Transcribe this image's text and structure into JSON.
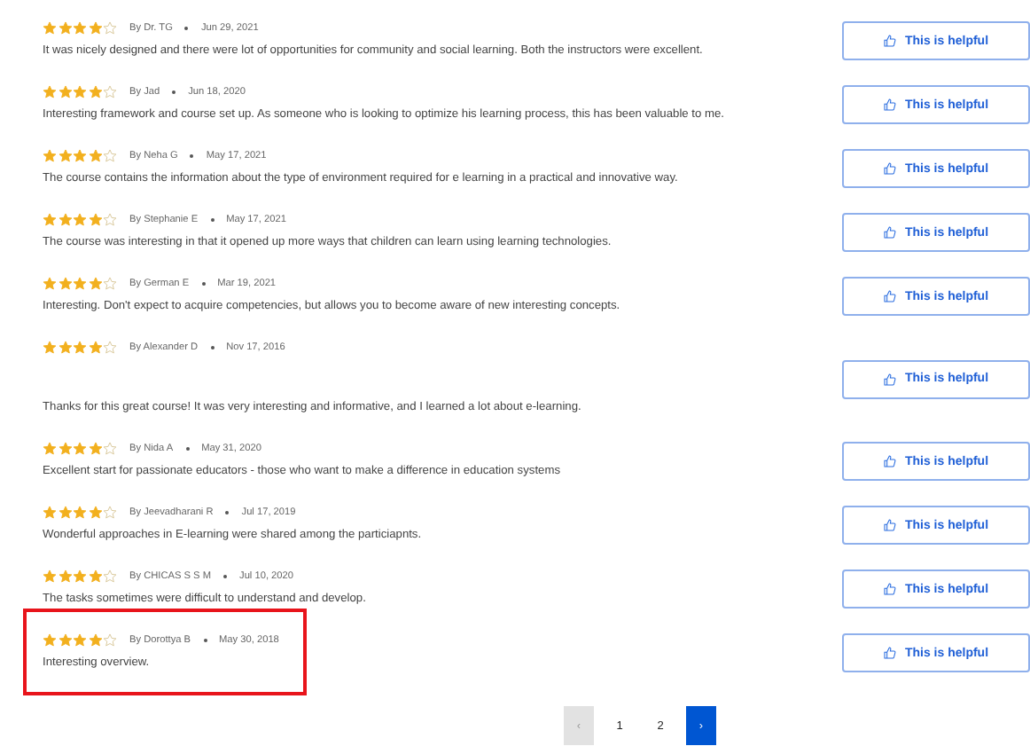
{
  "reviews": [
    {
      "stars": 4,
      "author": "By Dr. TG",
      "date": "Jun 29, 2021",
      "text": "It was nicely designed and there were lot of opportunities for community and social learning. Both the instructors were excellent.",
      "blank_line_before": false,
      "highlighted": false,
      "button": "This is helpful"
    },
    {
      "stars": 4,
      "author": "By Jad",
      "date": "Jun 18, 2020",
      "text": "Interesting framework and course set up. As someone who is looking to optimize his learning process, this has been valuable to me.",
      "blank_line_before": false,
      "highlighted": false,
      "button": "This is helpful"
    },
    {
      "stars": 4,
      "author": "By Neha G",
      "date": "May 17, 2021",
      "text": "The course contains the information about the type of environment required for e learning in a practical and innovative way.",
      "blank_line_before": false,
      "highlighted": false,
      "button": "This is helpful"
    },
    {
      "stars": 4,
      "author": "By Stephanie E",
      "date": "May 17, 2021",
      "text": "The course was interesting in that it opened up more ways that children can learn using learning technologies.",
      "blank_line_before": false,
      "highlighted": false,
      "button": "This is helpful"
    },
    {
      "stars": 4,
      "author": "By German E",
      "date": "Mar 19, 2021",
      "text": "Interesting. Don't expect to acquire competencies, but allows you to become aware of new interesting concepts.",
      "blank_line_before": false,
      "highlighted": false,
      "button": "This is helpful"
    },
    {
      "stars": 4,
      "author": "By Alexander D",
      "date": "Nov 17, 2016",
      "text": "Thanks for this great course! It was very interesting and informative, and I learned a lot about e-learning.",
      "blank_line_before": true,
      "highlighted": false,
      "button": "This is helpful"
    },
    {
      "stars": 4,
      "author": "By Nida A",
      "date": "May 31, 2020",
      "text": "Excellent start for passionate educators - those who want to make a difference in education systems",
      "blank_line_before": false,
      "highlighted": false,
      "button": "This is helpful"
    },
    {
      "stars": 4,
      "author": "By Jeevadharani R",
      "date": "Jul 17, 2019",
      "text": "Wonderful approaches in E-learning were shared among the particiapnts.",
      "blank_line_before": false,
      "highlighted": false,
      "button": "This is helpful"
    },
    {
      "stars": 4,
      "author": "By CHICAS S S M",
      "date": "Jul 10, 2020",
      "text": "The tasks sometimes were difficult to understand and develop.",
      "blank_line_before": false,
      "highlighted": false,
      "button": "This is helpful"
    },
    {
      "stars": 4,
      "author": "By Dorottya B",
      "date": "May 30, 2018",
      "text": "Interesting overview.",
      "blank_line_before": false,
      "highlighted": true,
      "button": "This is helpful"
    }
  ],
  "pagination": {
    "prev": {
      "label": "‹",
      "disabled": true
    },
    "pages": [
      {
        "label": "1",
        "selected": false
      },
      {
        "label": "2",
        "selected": false
      }
    ],
    "next": {
      "label": "›",
      "disabled": false
    }
  }
}
